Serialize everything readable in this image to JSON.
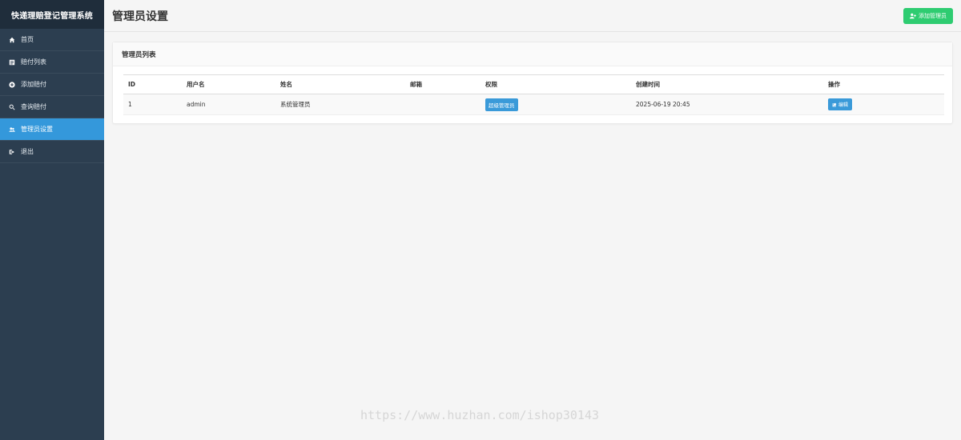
{
  "sidebar": {
    "title": "快递理赔登记管理系统",
    "items": [
      {
        "label": "首页",
        "icon": "home-icon",
        "active": false
      },
      {
        "label": "赔付列表",
        "icon": "list-icon",
        "active": false
      },
      {
        "label": "添加赔付",
        "icon": "plus-circle-icon",
        "active": false
      },
      {
        "label": "查询赔付",
        "icon": "search-icon",
        "active": false
      },
      {
        "label": "管理员设置",
        "icon": "users-icon",
        "active": true
      },
      {
        "label": "退出",
        "icon": "logout-icon",
        "active": false
      }
    ]
  },
  "header": {
    "title": "管理员设置",
    "add_button_label": "添加管理员"
  },
  "card": {
    "title": "管理员列表",
    "columns": [
      "ID",
      "用户名",
      "姓名",
      "邮箱",
      "权限",
      "创建时间",
      "操作"
    ],
    "rows": [
      {
        "id": "1",
        "username": "admin",
        "name": "系统管理员",
        "email": "",
        "role": "超级管理员",
        "created": "2025-06-19 20:45",
        "action_label": "编辑"
      }
    ]
  },
  "watermark": "https://www.huzhan.com/ishop30143",
  "colors": {
    "sidebar_bg": "#2c3e50",
    "active_item": "#3498db",
    "add_button": "#2ecc71",
    "badge": "#3a9ad9"
  }
}
